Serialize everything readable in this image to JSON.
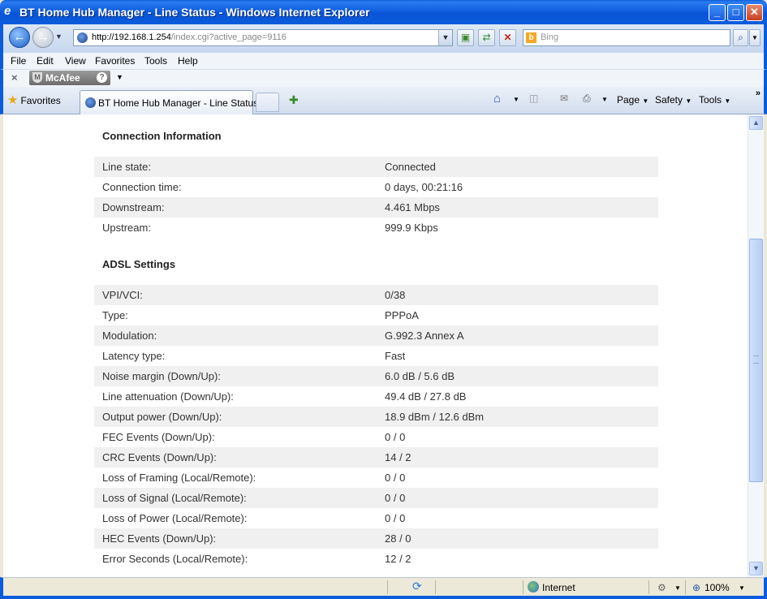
{
  "window": {
    "title": "BT Home Hub Manager - Line Status - Windows Internet Explorer",
    "minimize": "_",
    "maximize": "□",
    "close": "✕"
  },
  "address": {
    "url_host": "http://192.168.1.254",
    "url_path": "/index.cgi?active_page=9116",
    "search_placeholder": "Bing"
  },
  "menu": [
    "File",
    "Edit",
    "View",
    "Favorites",
    "Tools",
    "Help"
  ],
  "mcafee": {
    "label": "McAfee",
    "close": "×"
  },
  "tabs": {
    "favorites": "Favorites",
    "active_tab": "BT Home Hub Manager - Line Status"
  },
  "commands": {
    "page": "Page",
    "safety": "Safety",
    "tools": "Tools"
  },
  "connection": {
    "heading": "Connection Information",
    "rows": [
      {
        "label": "Line state:",
        "value": "Connected"
      },
      {
        "label": "Connection time:",
        "value": "0 days, 00:21:16"
      },
      {
        "label": "Downstream:",
        "value": "4.461 Mbps"
      },
      {
        "label": "Upstream:",
        "value": "999.9 Kbps"
      }
    ]
  },
  "adsl": {
    "heading": "ADSL Settings",
    "rows": [
      {
        "label": "VPI/VCI:",
        "value": "0/38"
      },
      {
        "label": "Type:",
        "value": "PPPoA"
      },
      {
        "label": "Modulation:",
        "value": "G.992.3 Annex A"
      },
      {
        "label": "Latency type:",
        "value": "Fast"
      },
      {
        "label": "Noise margin (Down/Up):",
        "value": "6.0 dB / 5.6 dB"
      },
      {
        "label": "Line attenuation (Down/Up):",
        "value": "49.4 dB / 27.8 dB"
      },
      {
        "label": "Output power (Down/Up):",
        "value": "18.9 dBm / 12.6 dBm"
      },
      {
        "label": "FEC Events (Down/Up):",
        "value": "0 / 0"
      },
      {
        "label": "CRC Events (Down/Up):",
        "value": "14 / 2"
      },
      {
        "label": "Loss of Framing (Local/Remote):",
        "value": "0 / 0"
      },
      {
        "label": "Loss of Signal (Local/Remote):",
        "value": "0 / 0"
      },
      {
        "label": "Loss of Power (Local/Remote):",
        "value": "0 / 0"
      },
      {
        "label": "HEC Events (Down/Up):",
        "value": "28 / 0"
      },
      {
        "label": "Error Seconds (Local/Remote):",
        "value": "12 / 2"
      }
    ]
  },
  "status": {
    "zone": "Internet",
    "zoom": "100%"
  }
}
